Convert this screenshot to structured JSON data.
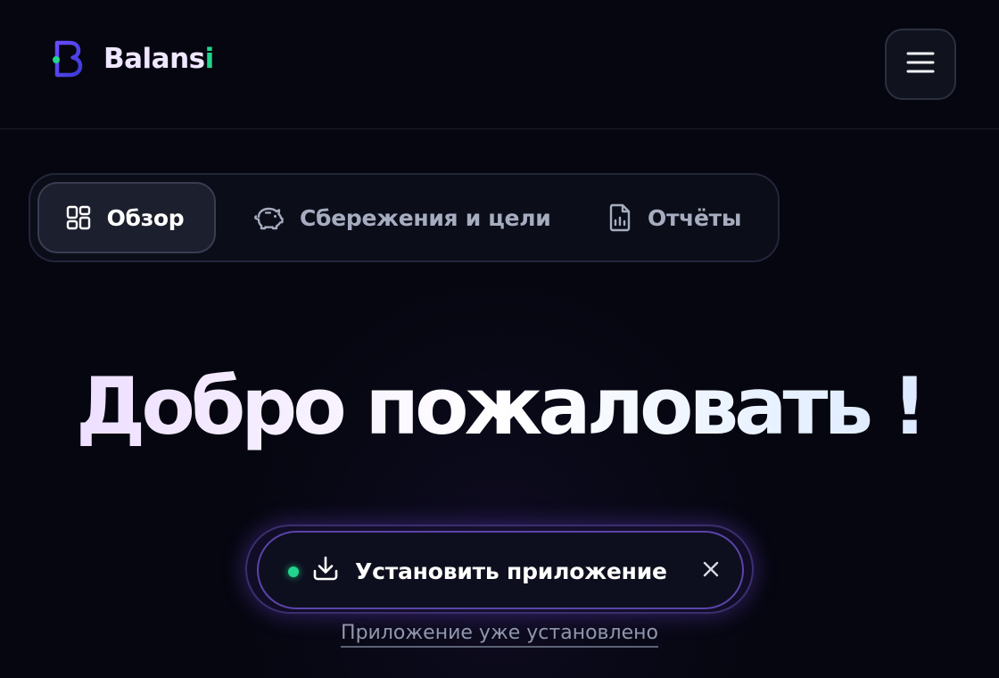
{
  "header": {
    "brand": {
      "name_main": "Balans",
      "name_accent": "i",
      "logo_icon": "b-logo-icon"
    },
    "menu_icon": "hamburger-menu-icon"
  },
  "tabs": [
    {
      "label": "Обзор",
      "icon": "grid-icon",
      "active": true
    },
    {
      "label": "Сбережения и цели",
      "icon": "piggy-bank-icon",
      "active": false
    },
    {
      "label": "Отчёты",
      "icon": "report-icon",
      "active": false
    }
  ],
  "hero": {
    "title": "Добро пожаловать !"
  },
  "install": {
    "label": "Установить приложение",
    "download_icon": "download-icon",
    "close_icon": "close-icon",
    "status_color": "#22d58d"
  },
  "installed_link": "Приложение уже установлено",
  "colors": {
    "background": "#05060f",
    "accent_green": "#22d58d",
    "accent_purple": "#5a44a8"
  }
}
